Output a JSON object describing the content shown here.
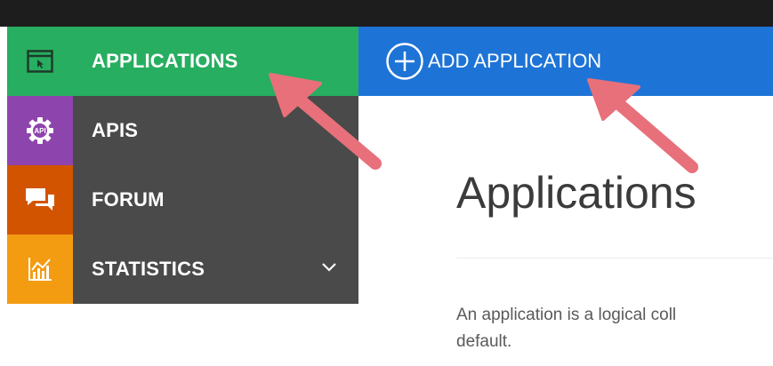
{
  "sidebar": {
    "items": [
      {
        "label": "APPLICATIONS",
        "icon": "window-icon",
        "active": true
      },
      {
        "label": "APIS",
        "icon": "api-gear-icon"
      },
      {
        "label": "FORUM",
        "icon": "chat-icon"
      },
      {
        "label": "STATISTICS",
        "icon": "bar-chart-icon",
        "has_submenu": true
      }
    ]
  },
  "header": {
    "add_label": "ADD APPLICATION"
  },
  "main": {
    "title": "Applications",
    "description_line1": "An application is a logical coll",
    "description_line2": "default."
  },
  "colors": {
    "applications": "#27ae60",
    "apis": "#8e44ad",
    "forum": "#d35400",
    "statistics": "#f39c12",
    "sidebar_bg": "#4a4a4a",
    "header_bg": "#1e74d6",
    "annotation_arrow": "#e8707a"
  }
}
